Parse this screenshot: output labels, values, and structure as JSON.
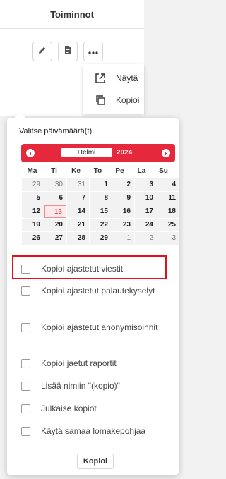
{
  "header": {
    "title": "Toiminnot",
    "buttons": [
      {
        "icon": "pencil-icon"
      },
      {
        "icon": "document-icon"
      },
      {
        "icon": "more-icon"
      }
    ]
  },
  "dropdown": {
    "items": [
      {
        "label": "Näytä",
        "icon": "external-link-icon"
      },
      {
        "label": "Kopioi",
        "icon": "copy-icon"
      }
    ]
  },
  "popup": {
    "title": "Valitse päivämäärä(t)",
    "calendar": {
      "month": "Helmi",
      "year": "2024",
      "weekdays": [
        "Ma",
        "Ti",
        "Ke",
        "To",
        "Pe",
        "La",
        "Su"
      ],
      "weeks": [
        [
          "29",
          "30",
          "31",
          "1",
          "2",
          "3",
          "4"
        ],
        [
          "5",
          "6",
          "7",
          "8",
          "9",
          "10",
          "11"
        ],
        [
          "12",
          "13",
          "14",
          "15",
          "16",
          "17",
          "18"
        ],
        [
          "19",
          "20",
          "21",
          "22",
          "23",
          "24",
          "25"
        ],
        [
          "26",
          "27",
          "28",
          "29",
          "1",
          "2",
          "3"
        ]
      ],
      "today": "13",
      "accent_color": "#e5283c"
    },
    "options": [
      {
        "label": "Kopioi ajastetut viestit",
        "checked": false,
        "highlighted": true
      },
      {
        "label": "Kopioi ajastetut palautekyselyt",
        "checked": false
      },
      {
        "label": "Kopioi ajastetut anonymisoinnit",
        "checked": false
      },
      {
        "label": "Kopioi jaetut raportit",
        "checked": false
      },
      {
        "label": "Lisää nimiin \"(kopio)\"",
        "checked": false
      },
      {
        "label": "Julkaise kopiot",
        "checked": false
      },
      {
        "label": "Käytä samaa lomakepohjaa",
        "checked": false
      }
    ],
    "submit_label": "Kopioi"
  }
}
